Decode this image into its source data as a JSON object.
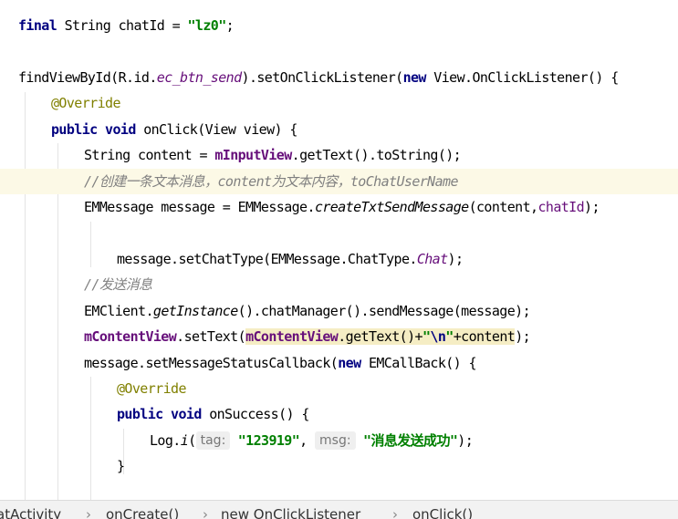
{
  "editor": {
    "lines": {
      "l1": {
        "kw_final": "final",
        "text1": " String chatId = ",
        "str": "\"lz0\"",
        "text2": ";"
      },
      "l2": {
        "method": "findViewById(R.id.",
        "field": "ec_btn_send",
        "text1": ").setOnClickListener(",
        "kw_new": "new",
        "text2": " View.OnClickListener() {"
      },
      "l3": {
        "anno": "@Override"
      },
      "l4": {
        "kw_public": "public",
        "sp": " ",
        "kw_void": "void",
        "text": " onClick(View view) {"
      },
      "l5": {
        "text1": "String content = ",
        "field": "mInputView",
        "text2": ".getText().toString();"
      },
      "l6": {
        "comment": "//创建一条文本消息，content为文本内容，toChatUserName"
      },
      "l7": {
        "text1": "EMMessage message = EMMessage.",
        "method": "createTxtSendMessage",
        "text2": "(content,",
        "param": "chatId",
        "text3": ");"
      },
      "l8": {
        "text1": "message.setChatType(EMMessage.ChatType.",
        "const": "Chat",
        "text2": ");"
      },
      "l9": {
        "comment": "//发送消息"
      },
      "l10": {
        "text1": "EMClient.",
        "method": "getInstance",
        "text2": "().chatManager().sendMessage(message);"
      },
      "l11": {
        "field1": "mContentView",
        "text1": ".setText(",
        "field2": "mContentView",
        "text2": ".getText()+",
        "str_open": "\"",
        "esc": "\\n",
        "str_close": "\"",
        "text3": "+content",
        "text4": ");"
      },
      "l12": {
        "text1": "message.setMessageStatusCallback(",
        "kw_new": "new",
        "text2": " EMCallBack() {"
      },
      "l13": {
        "anno": "@Override"
      },
      "l14": {
        "kw_public": "public",
        "sp": " ",
        "kw_void": "void",
        "text": " onSuccess() {"
      },
      "l15": {
        "text1": "Log.",
        "method": "i",
        "text2": "(",
        "hint_tag": "tag:",
        "str1": "\"123919\"",
        "comma": ",",
        "hint_msg": "msg:",
        "str2": "\"消息发送成功\"",
        "text3": ");"
      },
      "l16": {
        "text": "}"
      }
    }
  },
  "breadcrumb": {
    "items": [
      "atActivity",
      "onCreate()",
      "new OnClickListener",
      "onClick()"
    ],
    "separator": "›"
  },
  "colors": {
    "keyword": "#000080",
    "string": "#008000",
    "annotation": "#808000",
    "field": "#660e7a",
    "comment": "#808080",
    "current_line": "#fcf9e6",
    "highlight": "#f5edc4"
  }
}
